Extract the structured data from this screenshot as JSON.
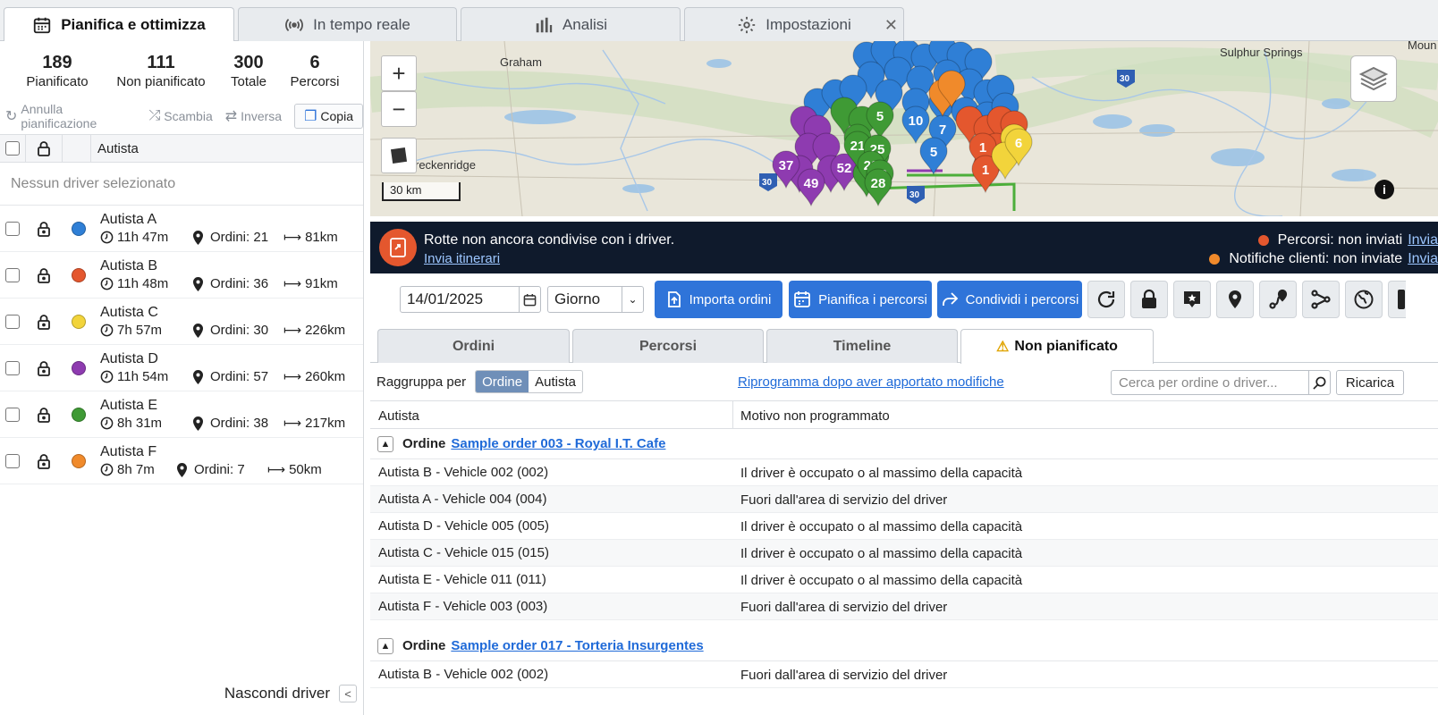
{
  "tabs": [
    {
      "label": "Pianifica e ottimizza",
      "icon": "calendar-icon"
    },
    {
      "label": "In tempo reale",
      "icon": "broadcast-icon"
    },
    {
      "label": "Analisi",
      "icon": "bar-chart-icon"
    },
    {
      "label": "Impostazioni",
      "icon": "gear-icon"
    }
  ],
  "stats": [
    {
      "value": "189",
      "label": "Pianificato"
    },
    {
      "value": "111",
      "label": "Non pianificato"
    },
    {
      "value": "300",
      "label": "Totale"
    },
    {
      "value": "6",
      "label": "Percorsi"
    }
  ],
  "actions": {
    "undo": "Annulla pianificazione",
    "swap": "Scambia",
    "reverse": "Inversa",
    "copy": "Copia"
  },
  "driver_header": "Autista",
  "no_driver": "Nessun driver selezionato",
  "drivers": [
    {
      "name": "Autista A",
      "time": "11h 47m",
      "orders": "Ordini: 21",
      "dist": "81km",
      "color": "#2f7fd6"
    },
    {
      "name": "Autista B",
      "time": "11h 48m",
      "orders": "Ordini: 36",
      "dist": "91km",
      "color": "#e4572e"
    },
    {
      "name": "Autista C",
      "time": "7h 57m",
      "orders": "Ordini: 30",
      "dist": "226km",
      "color": "#f2d43b"
    },
    {
      "name": "Autista D",
      "time": "11h 54m",
      "orders": "Ordini: 57",
      "dist": "260km",
      "color": "#8e3bb0"
    },
    {
      "name": "Autista E",
      "time": "8h 31m",
      "orders": "Ordini: 38",
      "dist": "217km",
      "color": "#3f9a35"
    },
    {
      "name": "Autista F",
      "time": "8h 7m",
      "orders": "Ordini: 7",
      "dist": "50km",
      "color": "#f08a2b"
    }
  ],
  "hide_drivers": "Nascondi driver",
  "map": {
    "labels": [
      "Graham",
      "Sulphur Springs",
      "Moun",
      "reckenridge",
      "30 km",
      "30",
      "30",
      "30"
    ],
    "pin_numbers": [
      "5",
      "10",
      "7",
      "37",
      "49",
      "52",
      "21",
      "25",
      "22",
      "20",
      "28",
      "5",
      "1",
      "1",
      "6"
    ],
    "scale": "30 km"
  },
  "banner": {
    "message": "Rotte non ancora condivise con i driver.",
    "share_link": "Invia itinerari",
    "status1": "Percorsi: non inviati",
    "status2": "Notifiche clienti: non inviate",
    "send": "Invia"
  },
  "toolbar": {
    "date": "14/01/2025",
    "period": "Giorno",
    "import": "Importa ordini",
    "plan": "Pianifica i percorsi",
    "share": "Condividi i percorsi"
  },
  "subtabs": [
    "Ordini",
    "Percorsi",
    "Timeline",
    "Non pianificato"
  ],
  "group": {
    "label": "Raggruppa per",
    "opt1": "Ordine",
    "opt2": "Autista",
    "reschedule": "Riprogramma dopo aver apportato modifiche",
    "search_placeholder": "Cerca per ordine o driver...",
    "reload": "Ricarica"
  },
  "table": {
    "col1": "Autista",
    "col2": "Motivo non programmato",
    "groups": [
      {
        "prefix": "Ordine",
        "order": "Sample order 003 - Royal I.T. Cafe",
        "rows": [
          {
            "driver": "Autista B - Vehicle 002 (002)",
            "reason": "Il driver è occupato o al massimo della capacità"
          },
          {
            "driver": "Autista A - Vehicle 004 (004)",
            "reason": "Fuori dall'area di servizio del driver"
          },
          {
            "driver": "Autista D - Vehicle 005 (005)",
            "reason": "Il driver è occupato o al massimo della capacità"
          },
          {
            "driver": "Autista C - Vehicle 015 (015)",
            "reason": "Il driver è occupato o al massimo della capacità"
          },
          {
            "driver": "Autista E - Vehicle 011 (011)",
            "reason": "Il driver è occupato o al massimo della capacità"
          },
          {
            "driver": "Autista F - Vehicle 003 (003)",
            "reason": "Fuori dall'area di servizio del driver"
          }
        ]
      },
      {
        "prefix": "Ordine",
        "order": "Sample order 017 - Torteria Insurgentes",
        "rows": [
          {
            "driver": "Autista B - Vehicle 002 (002)",
            "reason": "Fuori dall'area di servizio del driver"
          }
        ]
      }
    ]
  }
}
